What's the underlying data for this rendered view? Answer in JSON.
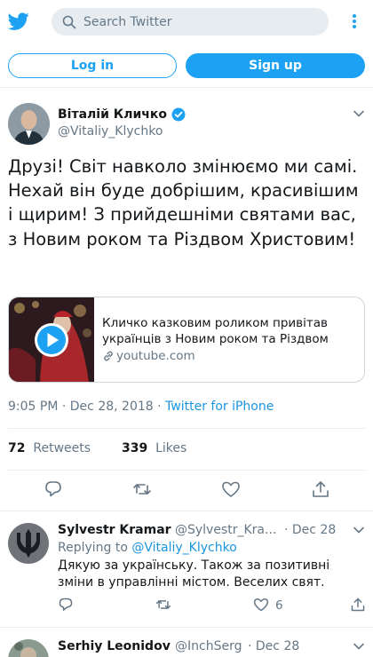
{
  "header": {
    "search_placeholder": "Search Twitter",
    "login_label": "Log in",
    "signup_label": "Sign up"
  },
  "colors": {
    "accent": "#1da1f2",
    "link": "#1b95e0",
    "muted": "#657786",
    "text": "#14171a",
    "border": "#e6ecf0"
  },
  "tweet": {
    "author_name": "Віталій Кличко",
    "author_handle": "@Vitaliy_Klychko",
    "verified": true,
    "text": "Друзі! Світ навколо змінюємо ми самі. Нехай він буде добрішим, красивішим і щирим! З прийдешніми святами вас, з Новим роком та Різдвом Христовим!",
    "card": {
      "title": "Кличко казковим роликом привітав українців з Новим роком та Різдвом",
      "domain": "youtube.com"
    },
    "time": "9:05 PM",
    "date": "Dec 28, 2018",
    "source": "Twitter for iPhone",
    "separator": "·",
    "retweets_count": "72",
    "retweets_label": "Retweets",
    "likes_count": "339",
    "likes_label": "Likes"
  },
  "replies": [
    {
      "name": "Sylvestr Kramar",
      "handle": "@Sylvestr_Kra...",
      "date": "· Dec 28",
      "replying_prefix": "Replying to",
      "replying_to": "@Vitaliy_Klychko",
      "text_line1": "Дякую за українську. Також за позитивні",
      "text_line2": "зміни в управлінні містом. Веселих свят.",
      "likes": "6"
    },
    {
      "name": "Serhiy Leonidov",
      "handle": "@InchSerg",
      "date": "· Dec 28"
    }
  ],
  "icons": [
    "twitter-logo-icon",
    "search-icon",
    "more-vertical-icon",
    "verified-badge-icon",
    "chevron-down-icon",
    "play-icon",
    "link-icon",
    "reply-icon",
    "retweet-icon",
    "like-icon",
    "share-icon"
  ]
}
